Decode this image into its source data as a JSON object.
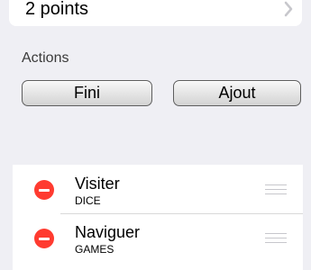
{
  "top_cell": {
    "label": "2 points",
    "chevron_icon": "chevron-right-icon"
  },
  "actions": {
    "header": "Actions",
    "buttons": [
      {
        "label": "Fini"
      },
      {
        "label": "Ajout"
      }
    ]
  },
  "list": {
    "items": [
      {
        "title": "Visiter",
        "subtitle": "DICE",
        "delete_icon": "minus-circle-icon",
        "reorder_icon": "reorder-handle-icon"
      },
      {
        "title": "Naviguer",
        "subtitle": "GAMES",
        "delete_icon": "minus-circle-icon",
        "reorder_icon": "reorder-handle-icon"
      }
    ]
  },
  "colors": {
    "background": "#efeff4",
    "delete": "#ff3b30",
    "handle": "#c7c7cc"
  }
}
